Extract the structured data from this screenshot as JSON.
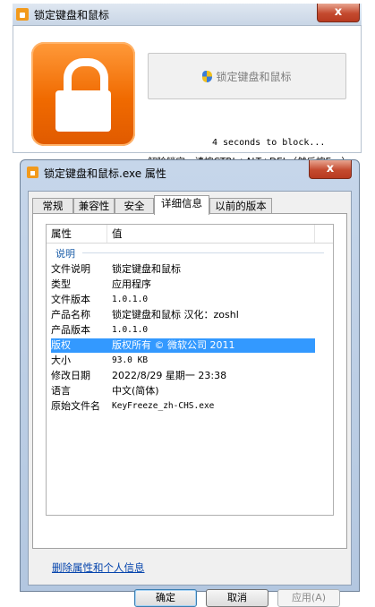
{
  "lock_window": {
    "title": "锁定键盘和鼠标",
    "close_glyph": "x",
    "button_label": "锁定键盘和鼠标",
    "countdown": "4 seconds to block...",
    "unlock_hint": "解除锁定，请按CTRL+ALT+DEL（然后按Esc）"
  },
  "props_window": {
    "title": "锁定键盘和鼠标.exe 属性",
    "close_glyph": "x",
    "tabs": [
      {
        "label": "常规"
      },
      {
        "label": "兼容性"
      },
      {
        "label": "安全"
      },
      {
        "label": "详细信息",
        "active": true
      },
      {
        "label": "以前的版本"
      }
    ],
    "columns": {
      "property": "属性",
      "value": "值"
    },
    "group_label": "说明",
    "rows": [
      {
        "key": "文件说明",
        "value": "锁定键盘和鼠标"
      },
      {
        "key": "类型",
        "value": "应用程序"
      },
      {
        "key": "文件版本",
        "value": "1.0.1.0"
      },
      {
        "key": "产品名称",
        "value": "锁定键盘和鼠标 汉化：zoshl"
      },
      {
        "key": "产品版本",
        "value": "1.0.1.0"
      },
      {
        "key": "版权",
        "value": "版权所有 © 微软公司 2011",
        "selected": true
      },
      {
        "key": "大小",
        "value": "93.0 KB"
      },
      {
        "key": "修改日期",
        "value": "2022/8/29 星期一 23:38"
      },
      {
        "key": "语言",
        "value": "中文(简体)"
      },
      {
        "key": "原始文件名",
        "value": "KeyFreeze_zh-CHS.exe"
      }
    ],
    "remove_link": "删除属性和个人信息",
    "buttons": {
      "ok": "确定",
      "cancel": "取消",
      "apply": "应用(A)"
    }
  },
  "colors": {
    "accent_orange": "#f06a00",
    "selection": "#3399ff",
    "link": "#0645ad"
  }
}
